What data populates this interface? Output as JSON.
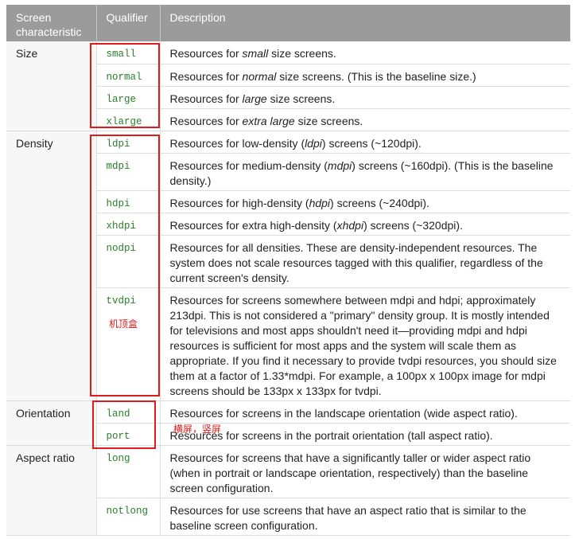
{
  "header": {
    "screen_characteristic": "Screen characteristic",
    "qualifier": "Qualifier",
    "description": "Description"
  },
  "groups": {
    "size": "Size",
    "density": "Density",
    "orientation": "Orientation",
    "aspect": "Aspect ratio"
  },
  "rows": [
    {
      "q": "small",
      "pre": "Resources for ",
      "em": "small",
      "post": " size screens."
    },
    {
      "q": "normal",
      "pre": "Resources for ",
      "em": "normal",
      "post": " size screens. (This is the baseline size.)"
    },
    {
      "q": "large",
      "pre": "Resources for ",
      "em": "large",
      "post": " size screens."
    },
    {
      "q": "xlarge",
      "pre": "Resources for ",
      "em": "extra large",
      "post": " size screens."
    },
    {
      "q": "ldpi",
      "pre": "Resources for low-density (",
      "em": "ldpi",
      "post": ") screens (~120dpi)."
    },
    {
      "q": "mdpi",
      "pre": "Resources for medium-density (",
      "em": "mdpi",
      "post": ") screens (~160dpi). (This is the baseline density.)"
    },
    {
      "q": "hdpi",
      "pre": "Resources for high-density (",
      "em": "hdpi",
      "post": ") screens (~240dpi)."
    },
    {
      "q": "xhdpi",
      "pre": "Resources for extra high-density (",
      "em": "xhdpi",
      "post": ") screens (~320dpi)."
    },
    {
      "q": "nodpi",
      "pre": "Resources for all densities. These are density-independent resources. The system does not scale resources tagged with this qualifier, regardless of the current screen's density.",
      "em": "",
      "post": ""
    },
    {
      "q": "tvdpi",
      "pre": "Resources for screens somewhere between mdpi and hdpi; approximately 213dpi. This is not considered a \"primary\" density group. It is mostly intended for televisions and most apps shouldn't need it—providing mdpi and hdpi resources is sufficient for most apps and the system will scale them as appropriate. If you find it necessary to provide tvdpi resources, you should size them at a factor of 1.33*mdpi. For example, a 100px x 100px image for mdpi screens should be 133px x 133px for tvdpi.",
      "em": "",
      "post": ""
    },
    {
      "q": "land",
      "pre": "Resources for screens in the landscape orientation (wide aspect ratio).",
      "em": "",
      "post": ""
    },
    {
      "q": "port",
      "pre": "Resources for screens in the portrait orientation (tall aspect ratio).",
      "em": "",
      "post": ""
    },
    {
      "q": "long",
      "pre": "Resources for screens that have a significantly taller or wider aspect ratio (when in portrait or landscape orientation, respectively) than the baseline screen configuration.",
      "em": "",
      "post": ""
    },
    {
      "q": "notlong",
      "pre": "Resources for use screens that have an aspect ratio that is similar to the baseline screen configuration.",
      "em": "",
      "post": ""
    }
  ],
  "annotations": {
    "tv_box": "机顶盒",
    "orientation": "横屏，竖屏",
    "box_color": "#e01b1b"
  }
}
